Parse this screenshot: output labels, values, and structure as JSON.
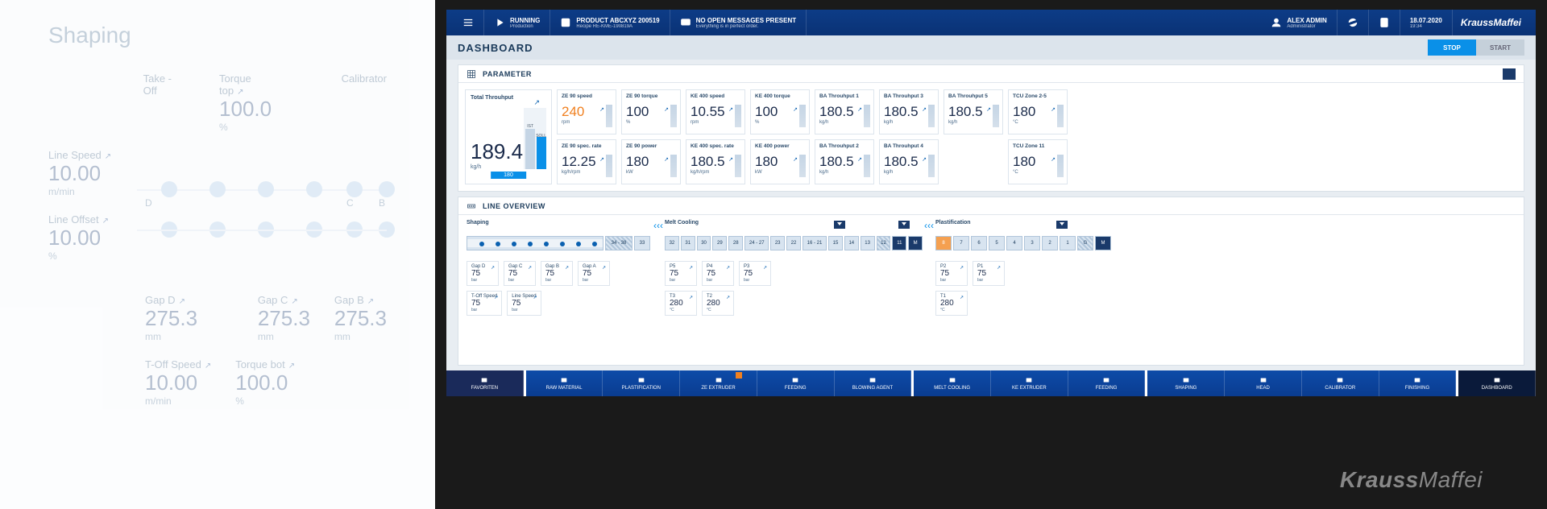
{
  "bg": {
    "title": "Shaping",
    "takeoff_label": "Take - Off",
    "torque_top_label": "Torque top",
    "torque_top_val": "100.0",
    "torque_top_unit": "%",
    "calibrator_label": "Calibrator",
    "line_speed_label": "Line Speed",
    "line_speed_val": "10.00",
    "line_speed_unit": "m/min",
    "line_offset_label": "Line Offset",
    "line_offset_val": "10.00",
    "line_offset_unit": "%",
    "zone_d": "D",
    "zone_c": "C",
    "zone_b": "B",
    "gap_d_label": "Gap D",
    "gap_d_val": "275.3",
    "gap_d_unit": "mm",
    "gap_c_label": "Gap C",
    "gap_c_val": "275.3",
    "gap_c_unit": "mm",
    "gap_b_label": "Gap B",
    "gap_b_val": "275.3",
    "gap_b_unit": "mm",
    "toff_speed_label": "T-Off Speed",
    "toff_speed_val": "10.00",
    "toff_speed_unit": "m/min",
    "torque_bot_label": "Torque bot",
    "torque_bot_val": "100.0",
    "torque_bot_unit": "%"
  },
  "header": {
    "running_l1": "RUNNING",
    "running_l2": "Production",
    "product_l1": "PRODUCT ABCXYZ 200519",
    "product_l2": "Recipe RE-KME-190819A",
    "messages_l1": "NO OPEN MESSAGES PRESENT",
    "messages_l2": "Everything is in perfect order.",
    "user_l1": "ALEX ADMIN",
    "user_l2": "Administrator",
    "date": "18.07.2020",
    "time": "19:34",
    "brand": "KraussMaffei"
  },
  "subhead": {
    "title": "DASHBOARD",
    "stop": "STOP",
    "start": "START"
  },
  "param": {
    "title": "PARAMETER",
    "total": {
      "label": "Total Throuhput",
      "val": "189.4",
      "unit": "kg/h",
      "ist": "IST",
      "soll": "SOLL",
      "base": "180"
    },
    "tiles_row1a": [
      {
        "label": "ZE 90 speed",
        "val": "240",
        "unit": "rpm",
        "orange": true
      },
      {
        "label": "ZE 90 torque",
        "val": "100",
        "unit": "%"
      }
    ],
    "tiles_row2a": [
      {
        "label": "ZE 90 spec. rate",
        "val": "12.25",
        "unit": "kg/h/rpm"
      },
      {
        "label": "ZE 90 power",
        "val": "180",
        "unit": "kW"
      }
    ],
    "tiles_row1b": [
      {
        "label": "KE 400 speed",
        "val": "10.55",
        "unit": "rpm"
      },
      {
        "label": "KE 400  torque",
        "val": "100",
        "unit": "%"
      }
    ],
    "tiles_row2b": [
      {
        "label": "KE 400  spec. rate",
        "val": "180.5",
        "unit": "kg/h/rpm"
      },
      {
        "label": "KE 400  power",
        "val": "180",
        "unit": "kW"
      }
    ],
    "tiles_row1c": [
      {
        "label": "BA Throuhput 1",
        "val": "180.5",
        "unit": "kg/h"
      },
      {
        "label": "BA Throuhput 3",
        "val": "180.5",
        "unit": "kg/h"
      },
      {
        "label": "BA Throuhput 5",
        "val": "180.5",
        "unit": "kg/h"
      }
    ],
    "tiles_row2c": [
      {
        "label": "BA Throuhput 2",
        "val": "180.5",
        "unit": "kg/h"
      },
      {
        "label": "BA Throuhput 4",
        "val": "180.5",
        "unit": "kg/h"
      }
    ],
    "tiles_row1d": [
      {
        "label": "TCU Zone 2-5",
        "val": "180",
        "unit": "°C"
      }
    ],
    "tiles_row2d": [
      {
        "label": "TCU Zone 11",
        "val": "180",
        "unit": "°C"
      }
    ]
  },
  "overview": {
    "title": "LINE OVERVIEW",
    "shaping": {
      "title": "Shaping",
      "segs": [
        "34 - 38",
        "33"
      ],
      "meas1": [
        {
          "label": "Gap D",
          "val": "75",
          "unit": "bar"
        },
        {
          "label": "Gap C",
          "val": "75",
          "unit": "bar"
        },
        {
          "label": "Gap B",
          "val": "75",
          "unit": "bar"
        },
        {
          "label": "Gap A",
          "val": "75",
          "unit": "bar"
        }
      ],
      "meas2": [
        {
          "label": "T-Off Speed",
          "val": "75",
          "unit": "bar"
        },
        {
          "label": "Line Speed",
          "val": "75",
          "unit": "bar"
        }
      ]
    },
    "melt": {
      "title": "Melt Cooling",
      "segs": [
        "32",
        "31",
        "30",
        "29",
        "28",
        "24 - 27",
        "23",
        "22",
        "16 - 21",
        "15",
        "14",
        "13",
        "12",
        "11",
        "M"
      ],
      "meas1": [
        {
          "label": "P5",
          "val": "75",
          "unit": "bar"
        },
        {
          "label": "P4",
          "val": "75",
          "unit": "bar"
        },
        {
          "label": "P3",
          "val": "75",
          "unit": "bar"
        }
      ],
      "meas2": [
        {
          "label": "T3",
          "val": "280",
          "unit": "°C"
        },
        {
          "label": "T2",
          "val": "280",
          "unit": "°C"
        }
      ]
    },
    "plast": {
      "title": "Plastification",
      "segs": [
        "8",
        "7",
        "6",
        "5",
        "4",
        "3",
        "2",
        "1",
        "G",
        "M"
      ],
      "meas1": [
        {
          "label": "P2",
          "val": "75",
          "unit": "bar"
        },
        {
          "label": "P1",
          "val": "75",
          "unit": "bar"
        }
      ],
      "meas2": [
        {
          "label": "T1",
          "val": "280",
          "unit": "°C"
        }
      ]
    }
  },
  "nav": [
    "FAVORITEN",
    "RAW MATERIAL",
    "PLASTIFICATION",
    "ZE EXTRUDER",
    "FEEDING",
    "BLOWING AGENT",
    "MELT COOLING",
    "KE EXTRUDER",
    "FEEDING",
    "SHAPING",
    "HEAD",
    "CALIBRATOR",
    "FINISHING",
    "DASHBOARD"
  ],
  "brand": {
    "full": "KraussMaffei",
    "k": "Krauss",
    "m": "Maffei"
  }
}
